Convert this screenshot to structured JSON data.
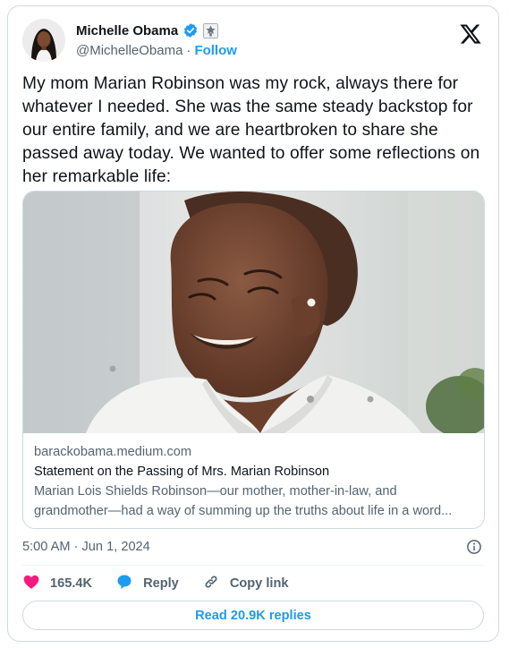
{
  "author": {
    "display_name": "Michelle Obama",
    "handle": "@MichelleObama",
    "separator": "·",
    "follow_label": "Follow",
    "avatar_icon": "profile-photo",
    "verified_icon": "verified-badge-icon",
    "affiliation_icon": "us-government-seal-icon"
  },
  "platform_logo": "x-logo-icon",
  "tweet": {
    "text": "My mom Marian Robinson was my rock, always there for whatever I needed. She was the same steady backstop for our entire family, and we are heartbroken to share she passed away today. We wanted to offer some reflections on her remarkable life:"
  },
  "link_card": {
    "domain": "barackobama.medium.com",
    "title": "Statement on the Passing of Mrs. Marian Robinson",
    "description_line1": "Marian Lois Shields Robinson—our mother, mother-in-law, and",
    "description_line2": "grandmother—had a way of summing up the truths about life in a word..."
  },
  "meta": {
    "timestamp": "5:00 AM · Jun 1, 2024",
    "info_icon": "info-icon"
  },
  "actions": {
    "like_count": "165.4K",
    "reply_label": "Reply",
    "copy_link_label": "Copy link"
  },
  "read_replies_label": "Read 20.9K replies",
  "colors": {
    "accent": "#1d9bf0",
    "like": "#f91880",
    "text": "#0f1419",
    "muted": "#536471",
    "border": "#cfd9de"
  }
}
